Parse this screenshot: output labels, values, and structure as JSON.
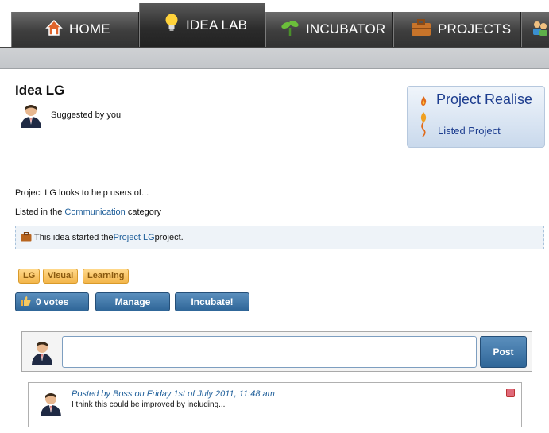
{
  "nav": {
    "tabs": [
      {
        "label": "HOME",
        "icon": "house-icon"
      },
      {
        "label": "IDEA LAB",
        "icon": "lightbulb-icon"
      },
      {
        "label": "INCUBATOR",
        "icon": "sprout-icon"
      },
      {
        "label": "PROJECTS",
        "icon": "briefcase-icon"
      },
      {
        "label": "",
        "icon": "people-icon"
      }
    ],
    "active": "IDEA LAB"
  },
  "idea": {
    "title": "Idea LG",
    "suggested_by": "Suggested by you",
    "description": "Project LG looks to help users of...",
    "listed_prefix": "Listed in the ",
    "category": "Communication",
    "listed_suffix": " category",
    "notice_prefix": "This idea started the ",
    "notice_link": "Project LG",
    "notice_suffix": " project."
  },
  "promo": {
    "line1": "Project Realise",
    "line2": "Listed Project"
  },
  "tags": [
    "LG",
    "Visual",
    "Learning"
  ],
  "actions": {
    "votes_label": "0 votes",
    "manage_label": "Manage",
    "incubate_label": "Incubate!"
  },
  "comment_form": {
    "input_value": "",
    "post_label": "Post"
  },
  "comments": [
    {
      "meta": "Posted by Boss on Friday 1st of July 2011, 11:48 am",
      "text": "I think this could be improved by including..."
    }
  ],
  "colors": {
    "accent_blue": "#2f6698",
    "link_blue": "#1f5f9a",
    "tag_orange": "#f3b64b",
    "nav_dark": "#333333"
  }
}
